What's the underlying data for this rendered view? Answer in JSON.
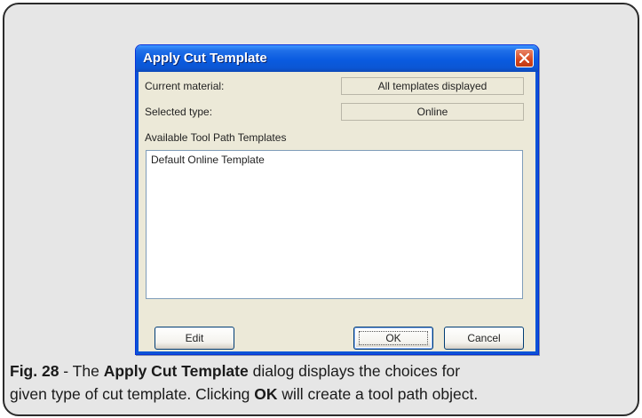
{
  "dialog": {
    "title": "Apply Cut Template",
    "current_material_label": "Current material:",
    "current_material_value": "All templates displayed",
    "selected_type_label": "Selected type:",
    "selected_type_value": "Online",
    "templates_label": "Available Tool Path Templates",
    "templates": [
      "Default Online Template"
    ],
    "edit_button": "Edit",
    "ok_button": "OK",
    "cancel_button": "Cancel"
  },
  "caption": {
    "fig_label": "Fig. 28",
    "sep": " - The ",
    "bold1": "Apply Cut Template",
    "mid1": " dialog displays the choices for",
    "line2_start": "given type of cut template. Clicking ",
    "bold2": "OK",
    "line2_end": " will create a tool path object."
  },
  "colors": {
    "titlebar": "#0a5be0",
    "dialog_face": "#ece9d8",
    "frame_bg": "#e6e6e6",
    "close_red": "#d6471f"
  },
  "icons": {
    "close": "close-x-icon"
  }
}
